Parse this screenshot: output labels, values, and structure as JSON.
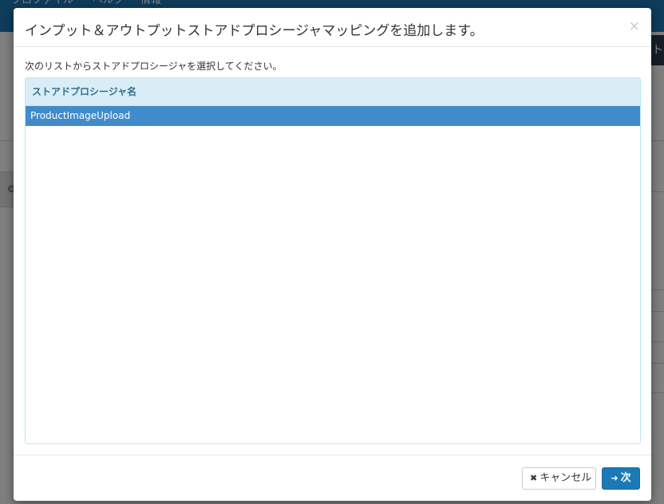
{
  "background": {
    "nav_items": [
      "プロファイル",
      "ヘルプ",
      "情報"
    ],
    "right_button_label": "ト"
  },
  "modal": {
    "title": "インプット＆アウトプットストアドプロシージャマッピングを追加します。",
    "close_symbol": "×",
    "instructions": "次のリストからストアドプロシージャを選択してください。",
    "table": {
      "header": "ストアドプロシージャ名",
      "rows": [
        {
          "name": "ProductImageUpload",
          "selected": true
        }
      ]
    },
    "footer": {
      "cancel_label": "キャンセル",
      "next_label": "次"
    }
  },
  "icons": {
    "cancel": "times-icon",
    "next": "arrow-right-icon",
    "close": "close-icon",
    "settings": "gear-icon"
  },
  "colors": {
    "navbar": "#1c79b7",
    "table_header_bg": "#d9edf7",
    "table_header_text": "#31708f",
    "selected_row": "#428bca",
    "primary_button": "#1c79b7"
  }
}
